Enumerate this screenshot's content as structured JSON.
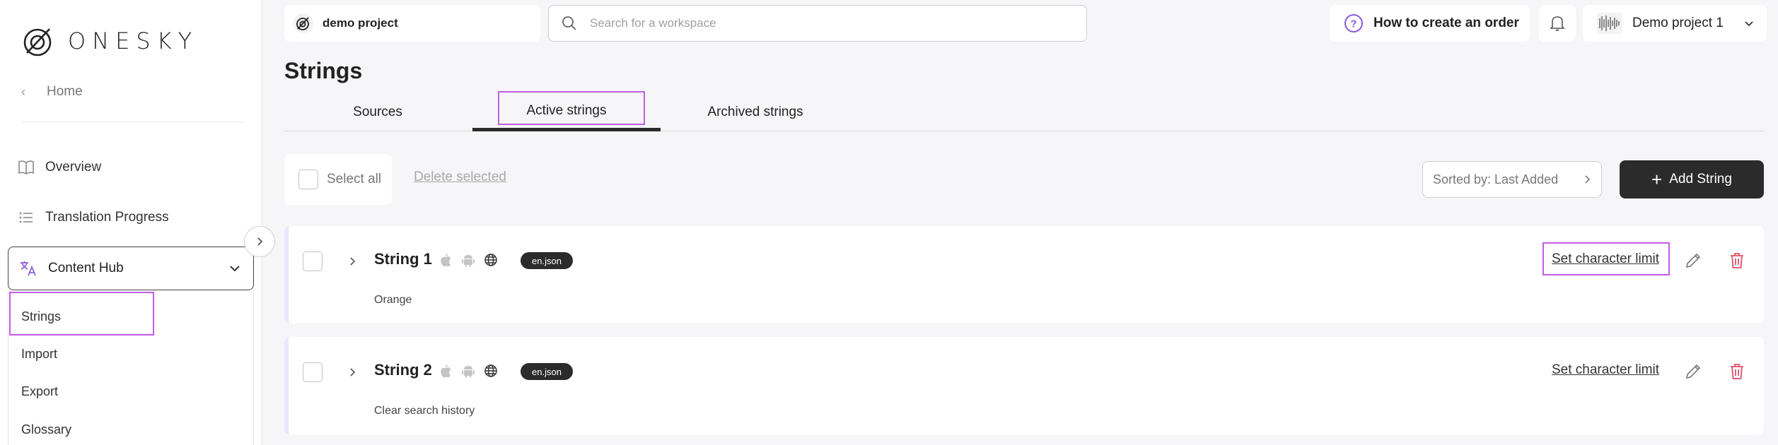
{
  "brand": {
    "logo_text": "ONESKY",
    "accent": "#c35ce8",
    "dark": "#2b2b2b",
    "danger": "#e0506a"
  },
  "sidebar": {
    "home": "Home",
    "items": [
      {
        "label": "Overview",
        "icon": "book-open-icon"
      },
      {
        "label": "Translation Progress",
        "icon": "list-icon"
      }
    ],
    "hub": {
      "label": "Content Hub",
      "icon": "translate-icon"
    },
    "submenu": [
      "Strings",
      "Import",
      "Export",
      "Glossary"
    ]
  },
  "topbar": {
    "project_name": "demo project",
    "search_placeholder": "Search for a workspace",
    "help_label": "How to create an order",
    "account_label": "Demo project 1"
  },
  "page": {
    "title": "Strings",
    "tabs": [
      "Sources",
      "Active strings",
      "Archived strings"
    ],
    "active_tab": "Active strings"
  },
  "toolbar": {
    "select_all": "Select all",
    "delete_selected": "Delete selected",
    "sort_label": "Sorted by: Last Added",
    "add_string": "Add String"
  },
  "strings": [
    {
      "name": "String 1",
      "file": "en.json",
      "value": "Orange",
      "char_limit_label": "Set character limit"
    },
    {
      "name": "String 2",
      "file": "en.json",
      "value": "Clear search history",
      "char_limit_label": "Set character limit"
    }
  ]
}
